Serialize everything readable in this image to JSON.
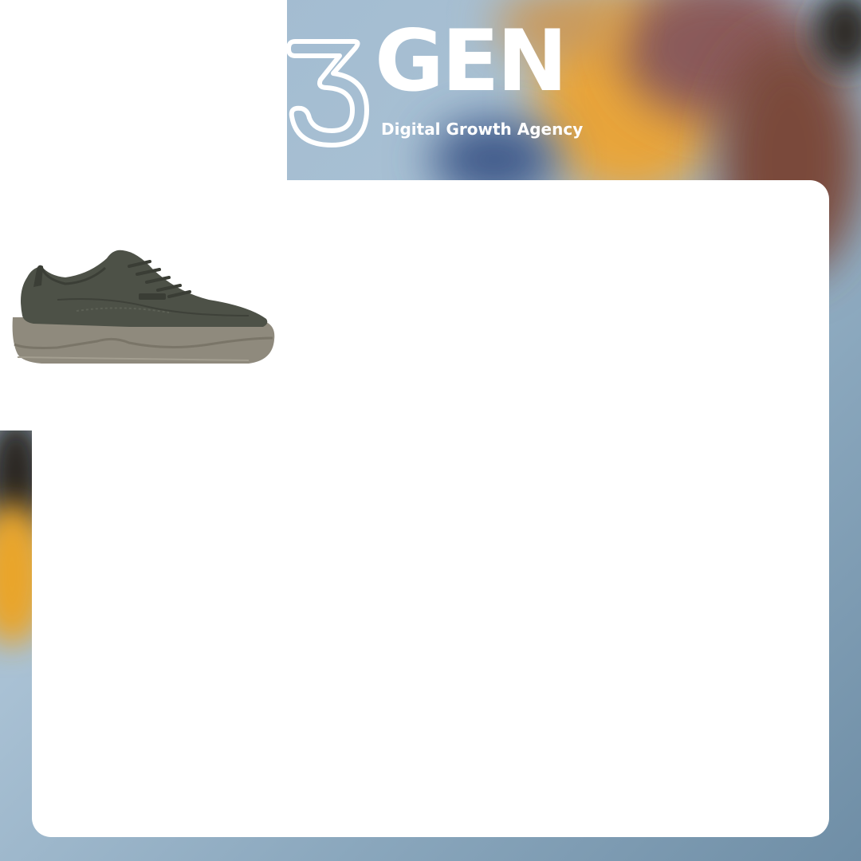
{
  "brand": {
    "wordmark": "GEN",
    "tagline": "Digital Growth Agency",
    "mark_icon": "stylized-3-logo-icon",
    "text_color": "#ffffff"
  },
  "product": {
    "icon": "sneaker-image",
    "upper_color": "#4d5147",
    "sole_color": "#8f8a7d"
  },
  "colors": {
    "background_blue": "#9fb9cf",
    "accent_orange": "#e8a53a",
    "card": "#ffffff"
  }
}
